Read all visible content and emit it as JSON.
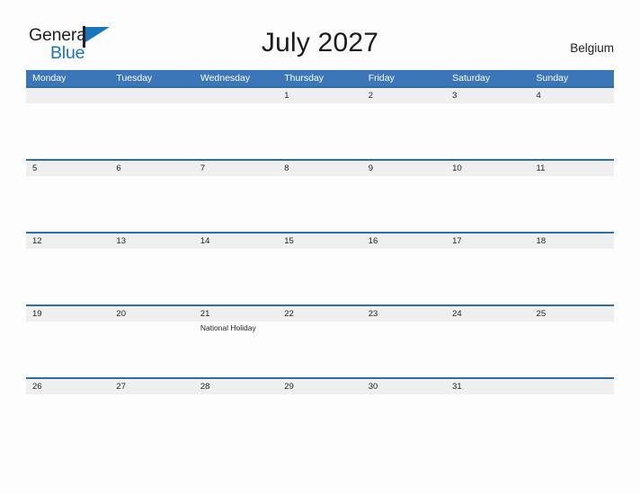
{
  "brand": {
    "name_top": "General",
    "name_bottom": "Blue",
    "flag_icon": "flag-triangle-icon"
  },
  "header": {
    "title": "July 2027",
    "country": "Belgium"
  },
  "calendar": {
    "weekdays": [
      "Monday",
      "Tuesday",
      "Wednesday",
      "Thursday",
      "Friday",
      "Saturday",
      "Sunday"
    ],
    "weeks": [
      {
        "days": [
          {
            "num": "",
            "event": ""
          },
          {
            "num": "",
            "event": ""
          },
          {
            "num": "",
            "event": ""
          },
          {
            "num": "1",
            "event": ""
          },
          {
            "num": "2",
            "event": ""
          },
          {
            "num": "3",
            "event": ""
          },
          {
            "num": "4",
            "event": ""
          }
        ]
      },
      {
        "days": [
          {
            "num": "5",
            "event": ""
          },
          {
            "num": "6",
            "event": ""
          },
          {
            "num": "7",
            "event": ""
          },
          {
            "num": "8",
            "event": ""
          },
          {
            "num": "9",
            "event": ""
          },
          {
            "num": "10",
            "event": ""
          },
          {
            "num": "11",
            "event": ""
          }
        ]
      },
      {
        "days": [
          {
            "num": "12",
            "event": ""
          },
          {
            "num": "13",
            "event": ""
          },
          {
            "num": "14",
            "event": ""
          },
          {
            "num": "15",
            "event": ""
          },
          {
            "num": "16",
            "event": ""
          },
          {
            "num": "17",
            "event": ""
          },
          {
            "num": "18",
            "event": ""
          }
        ]
      },
      {
        "days": [
          {
            "num": "19",
            "event": ""
          },
          {
            "num": "20",
            "event": ""
          },
          {
            "num": "21",
            "event": "National Holiday"
          },
          {
            "num": "22",
            "event": ""
          },
          {
            "num": "23",
            "event": ""
          },
          {
            "num": "24",
            "event": ""
          },
          {
            "num": "25",
            "event": ""
          }
        ]
      },
      {
        "days": [
          {
            "num": "26",
            "event": ""
          },
          {
            "num": "27",
            "event": ""
          },
          {
            "num": "28",
            "event": ""
          },
          {
            "num": "29",
            "event": ""
          },
          {
            "num": "30",
            "event": ""
          },
          {
            "num": "31",
            "event": ""
          },
          {
            "num": "",
            "event": ""
          }
        ]
      }
    ]
  },
  "colors": {
    "header_blue": "#3b77b8",
    "row_divider_blue": "#2e6da4",
    "daynum_band_gray": "#efeff0",
    "brand_blue": "#1b75bb",
    "page_background": "#fdfdfe"
  }
}
